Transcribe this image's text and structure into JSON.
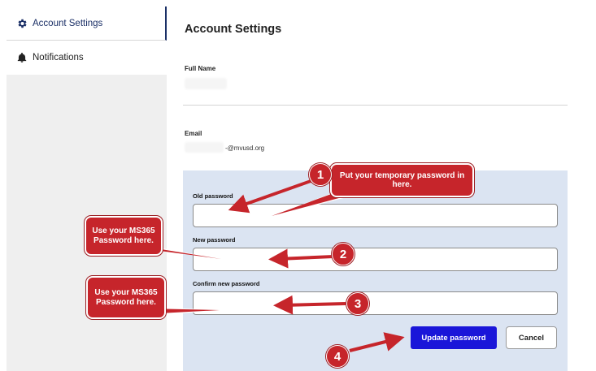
{
  "sidebar": {
    "items": [
      {
        "label": "Account Settings",
        "icon": "gear-icon",
        "active": true
      },
      {
        "label": "Notifications",
        "icon": "bell-icon",
        "active": false
      }
    ]
  },
  "main": {
    "title": "Account Settings",
    "full_name": {
      "label": "Full Name"
    },
    "email": {
      "label": "Email",
      "value_suffix": "-@mvusd.org"
    },
    "password": {
      "old_label": "Old password",
      "new_label": "New password",
      "confirm_label": "Confirm new password",
      "update_button": "Update password",
      "cancel_button": "Cancel"
    }
  },
  "annotations": {
    "callout_temp": "Put your temporary password in here.",
    "callout_ms365_new": "Use your MS365 Password here.",
    "callout_ms365_confirm": "Use your MS365 Password here.",
    "numbers": [
      "1",
      "2",
      "3",
      "4"
    ]
  },
  "colors": {
    "accent": "#1a16d9",
    "annotation_red": "#c6252b",
    "password_section_bg": "#dbe4f2",
    "sidebar_active": "#1a2f66"
  }
}
